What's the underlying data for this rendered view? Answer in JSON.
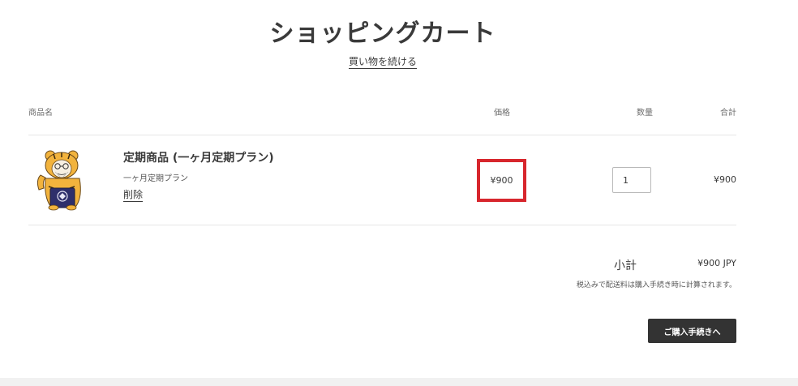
{
  "header": {
    "title": "ショッピングカート",
    "continue_shopping": "買い物を続ける"
  },
  "table": {
    "columns": {
      "product": "商品名",
      "price": "価格",
      "quantity": "数量",
      "total": "合計"
    }
  },
  "cart_items": [
    {
      "title": "定期商品 (一ヶ月定期プラン)",
      "variant": "一ヶ月定期プラン",
      "remove_label": "削除",
      "price": "¥900",
      "quantity": "1",
      "line_total": "¥900"
    }
  ],
  "summary": {
    "subtotal_label": "小計",
    "subtotal_value": "¥900 JPY",
    "tax_note": "税込みで配送料は購入手続き時に計算されます。",
    "checkout_label": "ご購入手続きへ"
  },
  "colors": {
    "highlight_border": "#d7262d",
    "button_bg": "#333333",
    "text": "#3a3a3a"
  }
}
